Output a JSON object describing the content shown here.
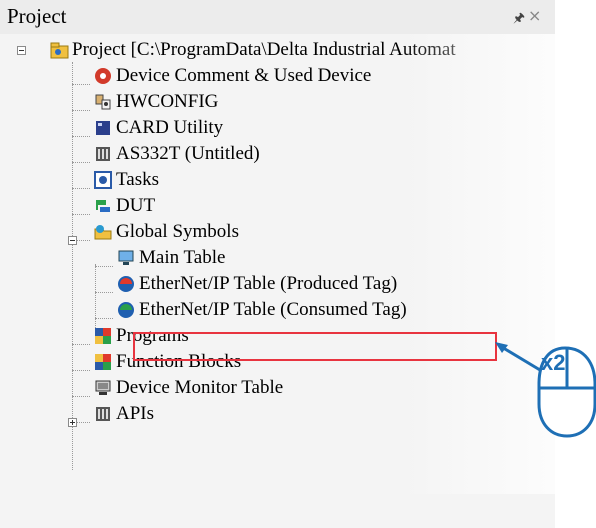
{
  "panel": {
    "title": "Project"
  },
  "tree": {
    "root": "Project [C:\\ProgramData\\Delta Industrial Automat",
    "device_comment": "Device Comment & Used Device",
    "hwconfig": "HWCONFIG",
    "card_utility": "CARD Utility",
    "as332t": "AS332T  (Untitled)",
    "tasks": "Tasks",
    "dut": "DUT",
    "global_symbols": "Global Symbols",
    "main_table": "Main Table",
    "eip_produced": "EtherNet/IP Table (Produced Tag)",
    "eip_consumed": "EtherNet/IP Table (Consumed Tag)",
    "programs": "Programs",
    "function_blocks": "Function Blocks",
    "device_monitor": "Device Monitor Table",
    "apis": "APIs"
  },
  "callout": {
    "double_click_badge": "x2",
    "accent_color": "#1e6fb5",
    "highlight_color": "#e8343f"
  }
}
